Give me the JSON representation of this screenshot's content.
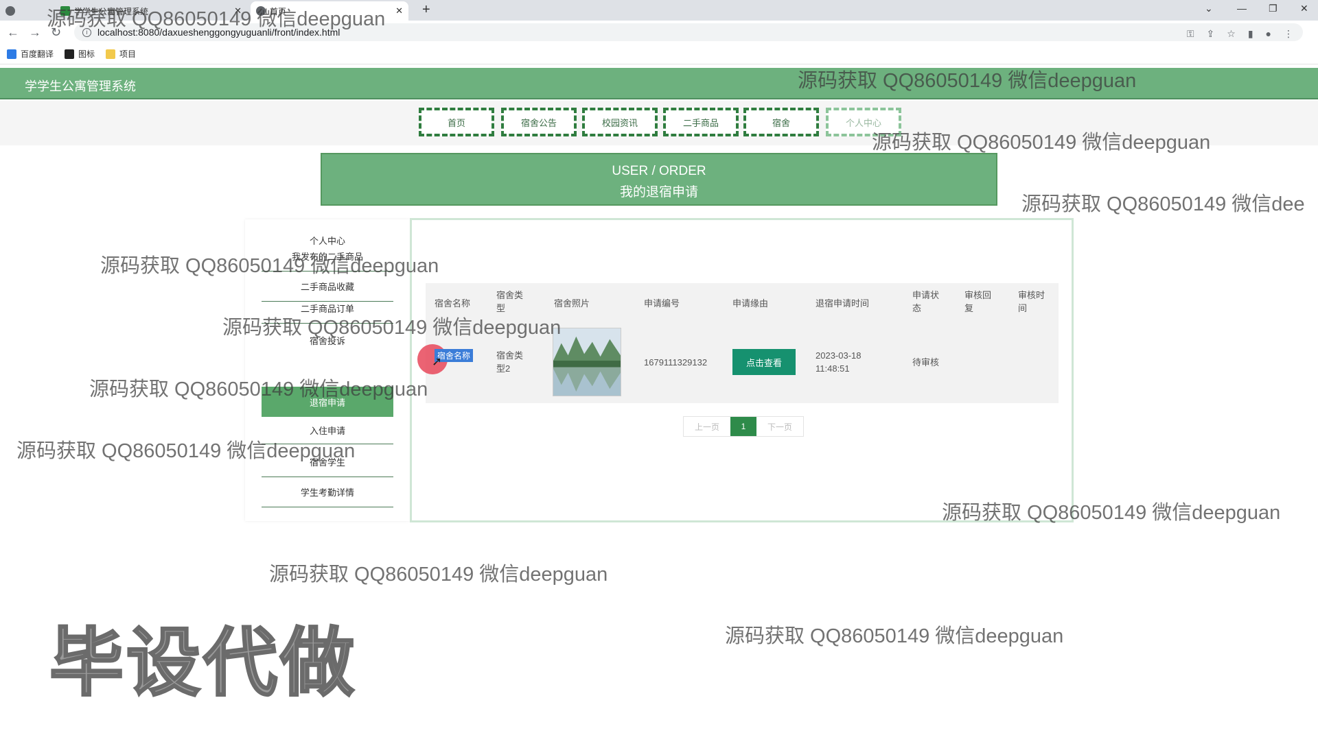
{
  "browser": {
    "tabs": [
      {
        "title": "",
        "active": false
      },
      {
        "title": "学学生公寓管理系统",
        "active": false
      },
      {
        "title": "首页",
        "active": true
      }
    ],
    "new_tab": "+",
    "url": "localhost:8080/daxueshenggongyuguanli/front/index.html",
    "bookmarks": [
      "百度翻译",
      "图标",
      "项目"
    ]
  },
  "site": {
    "title": "学学生公寓管理系统",
    "accent_color": "#6db17e"
  },
  "nav": {
    "items": [
      "首页",
      "宿舍公告",
      "校园资讯",
      "二手商品",
      "宿舍",
      "个人中心"
    ],
    "active": "个人中心"
  },
  "banner": {
    "en": "USER / ORDER",
    "cn": "我的退宿申请"
  },
  "sidebar": {
    "heading": "个人中心",
    "items": [
      "我发布的二手商品",
      "二手商品收藏",
      "二手商品订单",
      "宿舍投诉",
      "退宿申请",
      "入住申请",
      "宿舍学生",
      "学生考勤详情"
    ],
    "active": "退宿申请"
  },
  "table": {
    "headers": [
      "宿舍名称",
      "宿舍类型",
      "宿舍照片",
      "申请编号",
      "申请缘由",
      "退宿申请时间",
      "申请状态",
      "审核回复",
      "审核时间"
    ],
    "rows": [
      {
        "name": "宿舍名称",
        "type": "宿舍类型2",
        "photo": "landscape-photo",
        "code": "1679111329132",
        "reason_button": "点击查看",
        "time": "2023-03-18 11:48:51",
        "status": "待审核",
        "reply": "",
        "audit_time": ""
      }
    ]
  },
  "pagination": {
    "prev": "上一页",
    "current": "1",
    "next": "下一页"
  },
  "watermarks": {
    "text": "源码获取 QQ86050149 微信deepguan",
    "cut_text": "源码获取 QQ86050149 微信dee",
    "big": "毕设代做"
  }
}
